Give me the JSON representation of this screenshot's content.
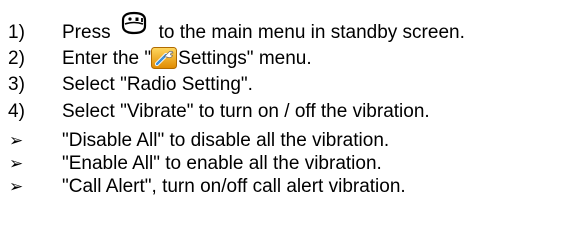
{
  "steps": [
    {
      "num": "1)",
      "before": "Press",
      "icon": "menu-key-icon",
      "after": "to the main menu in standby screen."
    },
    {
      "num": "2)",
      "before": "Enter the \"",
      "icon": "settings-icon",
      "after": "Settings\" menu."
    },
    {
      "num": "3)",
      "text": "Select \"Radio Setting\"."
    },
    {
      "num": "4)",
      "text": "Select \"Vibrate\" to turn on / off the vibration."
    }
  ],
  "bullets": [
    {
      "marker": "➢",
      "text": "\"Disable All\" to disable all the vibration."
    },
    {
      "marker": "➢",
      "text": "\"Enable All\" to enable all the vibration."
    },
    {
      "marker": "➢",
      "text": "\"Call Alert\", turn on/off call alert vibration."
    }
  ]
}
